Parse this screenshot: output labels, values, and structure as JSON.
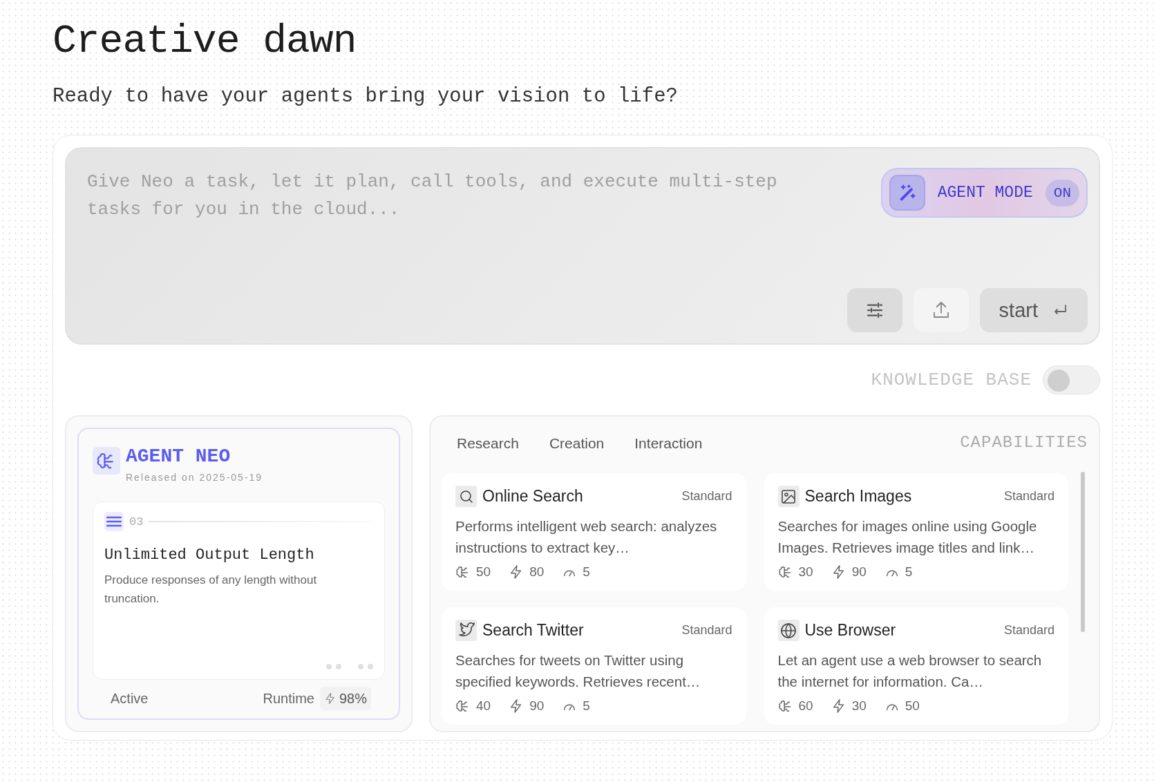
{
  "header": {
    "title": "Creative dawn",
    "subtitle": "Ready to have your agents bring your vision to life?"
  },
  "composer": {
    "placeholder": "Give Neo a task, let it plan, call tools, and execute multi-step tasks for you in the cloud...",
    "agent_mode": {
      "label": "AGENT MODE",
      "state": "ON",
      "on": true
    },
    "start_button": "start"
  },
  "knowledge_base": {
    "label": "KNOWLEDGE BASE",
    "on": false
  },
  "agent": {
    "name": "AGENT NEO",
    "released": "Released on 2025-05-19",
    "feature": {
      "index": "03",
      "title": "Unlimited Output Length",
      "description": "Produce responses of any length without truncation."
    },
    "status": "Active",
    "runtime_label": "Runtime",
    "runtime_value": "98%"
  },
  "capabilities": {
    "heading": "CAPABILITIES",
    "tabs": [
      "Research",
      "Creation",
      "Interaction"
    ],
    "items": [
      {
        "kind": "search",
        "name": "Online Search",
        "tier": "Standard",
        "description": "Performs intelligent web search: analyzes instructions to extract key…",
        "stats": [
          "50",
          "80",
          "5"
        ]
      },
      {
        "kind": "image",
        "name": "Search Images",
        "tier": "Standard",
        "description": "Searches for images online using Google Images. Retrieves image titles and link…",
        "stats": [
          "30",
          "90",
          "5"
        ]
      },
      {
        "kind": "twitter",
        "name": "Search Twitter",
        "tier": "Standard",
        "description": "Searches for tweets on Twitter using specified keywords. Retrieves recent…",
        "stats": [
          "40",
          "90",
          "5"
        ]
      },
      {
        "kind": "globe",
        "name": "Use Browser",
        "tier": "Standard",
        "description": "Let an agent use a web browser to search the internet for information. Ca…",
        "stats": [
          "60",
          "30",
          "50"
        ]
      }
    ]
  }
}
